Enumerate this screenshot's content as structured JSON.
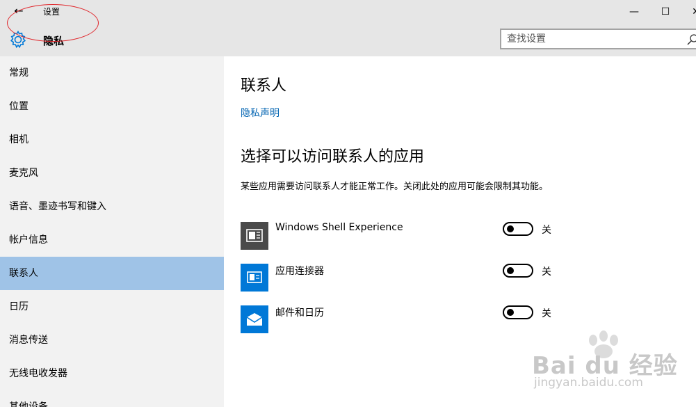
{
  "window": {
    "back_glyph": "←",
    "title": "设置",
    "minimize_glyph": "—",
    "maximize_glyph": "☐",
    "close_glyph": "✕"
  },
  "header": {
    "section_icon": "gear-icon",
    "section_title": "隐私",
    "search": {
      "placeholder": "查找设置",
      "value": ""
    }
  },
  "sidebar": {
    "items": [
      {
        "label": "常规"
      },
      {
        "label": "位置"
      },
      {
        "label": "相机"
      },
      {
        "label": "麦克风"
      },
      {
        "label": "语音、墨迹书写和键入"
      },
      {
        "label": "帐户信息"
      },
      {
        "label": "联系人",
        "active": true
      },
      {
        "label": "日历"
      },
      {
        "label": "消息传送"
      },
      {
        "label": "无线电收发器"
      },
      {
        "label": "其他设备"
      }
    ]
  },
  "main": {
    "heading": "联系人",
    "privacy_link": "隐私声明",
    "subheading": "选择可以访问联系人的应用",
    "description": "某些应用需要访问联系人才能正常工作。关闭此处的应用可能会限制其功能。",
    "apps": [
      {
        "name": "Windows Shell Experience",
        "icon": "shell-experience-icon",
        "icon_color": "#4a4a4a",
        "state": "关",
        "on": false
      },
      {
        "name": "应用连接器",
        "icon": "app-connector-icon",
        "icon_color": "#0078d7",
        "state": "关",
        "on": false
      },
      {
        "name": "邮件和日历",
        "icon": "mail-icon",
        "icon_color": "#0078d7",
        "state": "关",
        "on": false
      }
    ]
  },
  "watermark": {
    "logo_text": "Bai du 经验",
    "url": "jingyan.baidu.com"
  },
  "colors": {
    "accent": "#0078d7",
    "link": "#0063b1",
    "active_nav": "#9fc3e7",
    "header_bg": "#e6e6e6",
    "sidebar_bg": "#f2f2f2",
    "annotation": "#e0262b"
  }
}
